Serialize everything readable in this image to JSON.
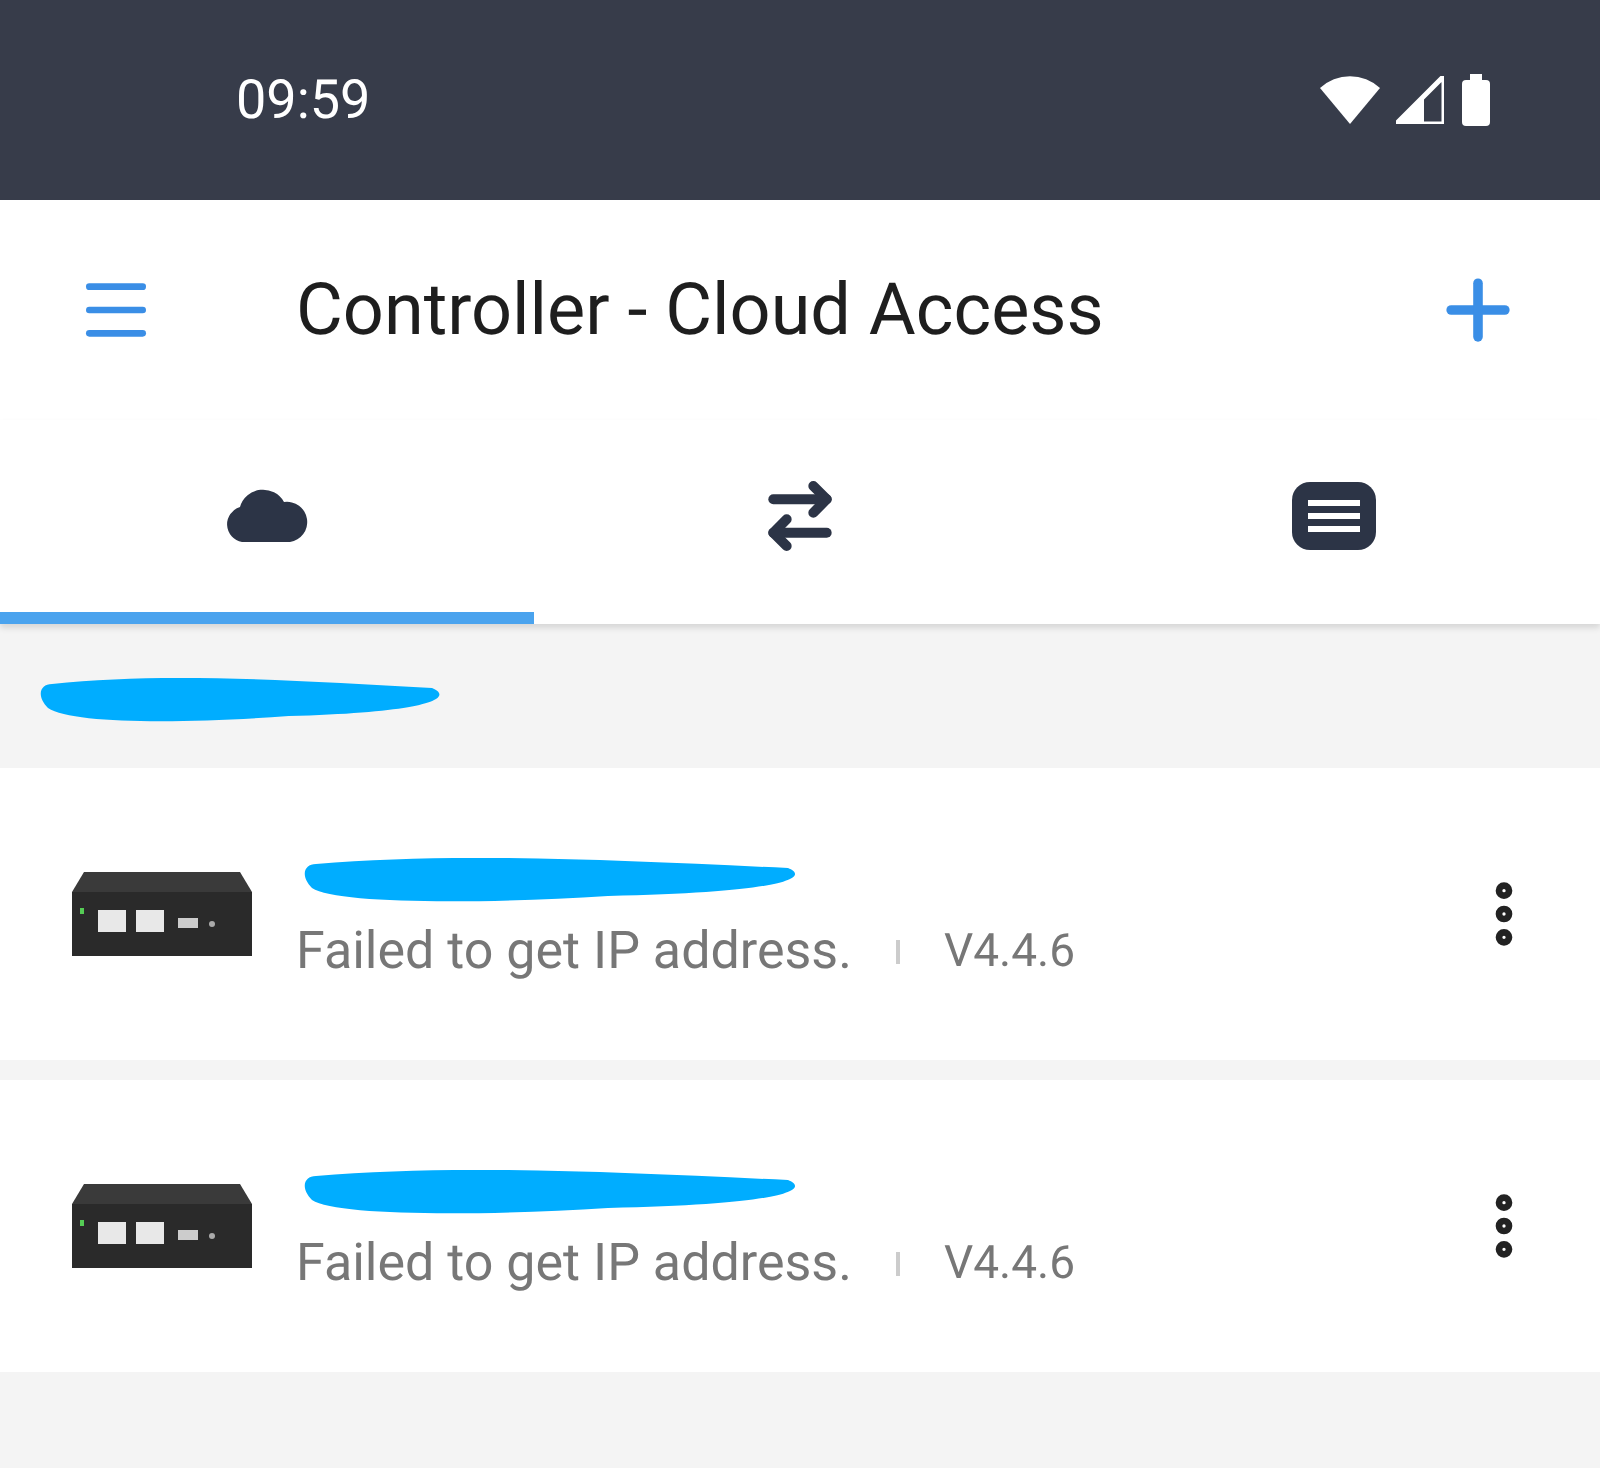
{
  "status_bar": {
    "time": "09:59"
  },
  "app_bar": {
    "title": "Controller - Cloud Access"
  },
  "tabs": [
    {
      "kind": "cloud",
      "selected": true
    },
    {
      "kind": "transfer",
      "selected": false
    },
    {
      "kind": "list",
      "selected": false
    }
  ],
  "devices": [
    {
      "status": "Failed to get IP address.",
      "version": "V4.4.6"
    },
    {
      "status": "Failed to get IP address.",
      "version": "V4.4.6"
    }
  ]
}
